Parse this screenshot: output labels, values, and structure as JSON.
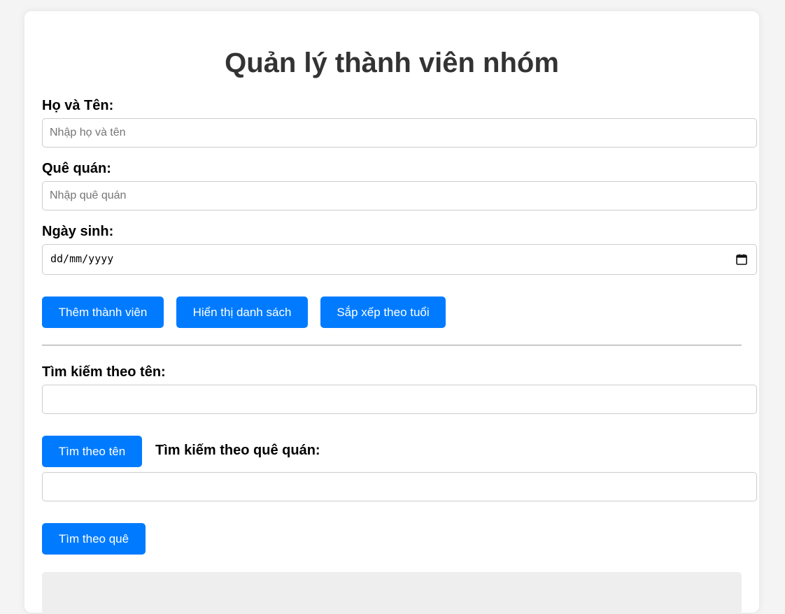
{
  "page": {
    "title": "Quản lý thành viên nhóm"
  },
  "form": {
    "name_label": "Họ và Tên:",
    "name_placeholder": "Nhập họ và tên",
    "hometown_label": "Quê quán:",
    "hometown_placeholder": "Nhập quê quán",
    "dob_label": "Ngày sinh:",
    "dob_placeholder": "dd/mm/yyyy"
  },
  "actions": {
    "add": "Thêm thành viên",
    "show_list": "Hiển thị danh sách",
    "sort_age": "Sắp xếp theo tuổi"
  },
  "search": {
    "by_name_label": "Tìm kiếm theo tên:",
    "by_name_value": "",
    "by_name_button": "Tìm theo tên",
    "by_hometown_label": "Tìm kiếm theo quê quán:",
    "by_hometown_value": "",
    "by_hometown_button": "Tìm theo quê"
  },
  "colors": {
    "accent": "#007bff",
    "background": "#f4f4f4",
    "card": "#ffffff",
    "title": "#333333"
  },
  "icons": {
    "date_picker": "calendar-icon"
  }
}
